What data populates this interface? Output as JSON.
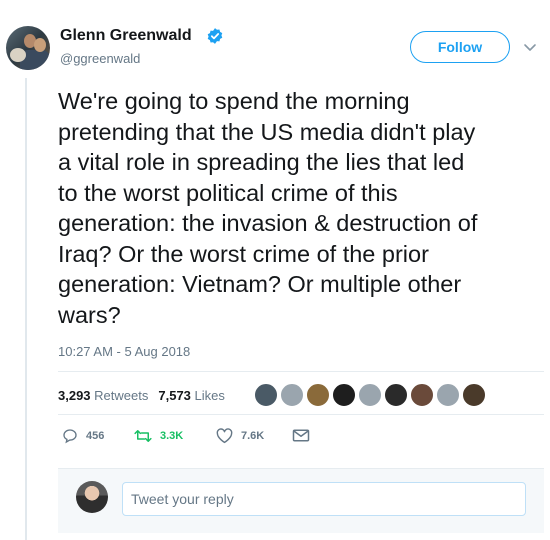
{
  "author": {
    "name": "Glenn Greenwald",
    "handle": "@ggreenwald",
    "verified": true
  },
  "follow_label": "Follow",
  "tweet": {
    "text": "We're going to spend the morning\npretending that the US media didn't play\na vital role in spreading the lies that led\nto the worst political crime of this\ngeneration: the invasion & destruction of\nIraq? Or the worst crime of the prior\ngeneration: Vietnam? Or multiple other\nwars?",
    "timestamp": "10:27 AM - 5 Aug 2018"
  },
  "stats": {
    "retweets_count": "3,293",
    "retweets_label": "Retweets",
    "likes_count": "7,573",
    "likes_label": "Likes"
  },
  "likers": [
    {
      "name": "liker-1",
      "color": "#4a5a66"
    },
    {
      "name": "liker-2",
      "color": "#9aa5ae"
    },
    {
      "name": "liker-3",
      "color": "#8a6a3a"
    },
    {
      "name": "liker-4",
      "color": "#1e1e1e"
    },
    {
      "name": "liker-5",
      "color": "#9aa5ae"
    },
    {
      "name": "liker-6",
      "color": "#2a2a2a"
    },
    {
      "name": "liker-7",
      "color": "#6a4a3a"
    },
    {
      "name": "liker-8",
      "color": "#9aa5ae"
    },
    {
      "name": "liker-9",
      "color": "#4a3a2a"
    }
  ],
  "actions": {
    "reply_count": "456",
    "retweet_count": "3.3K",
    "like_count": "7.6K"
  },
  "reply": {
    "placeholder": "Tweet your reply"
  },
  "colors": {
    "accent": "#1da1f2",
    "retweet_green": "#17bf63",
    "muted": "#657786",
    "text": "#14171a"
  },
  "icons": {
    "verified": "verified-badge-icon",
    "caret": "chevron-down-icon",
    "reply": "reply-icon",
    "retweet": "retweet-icon",
    "like": "heart-icon",
    "dm": "envelope-icon"
  }
}
